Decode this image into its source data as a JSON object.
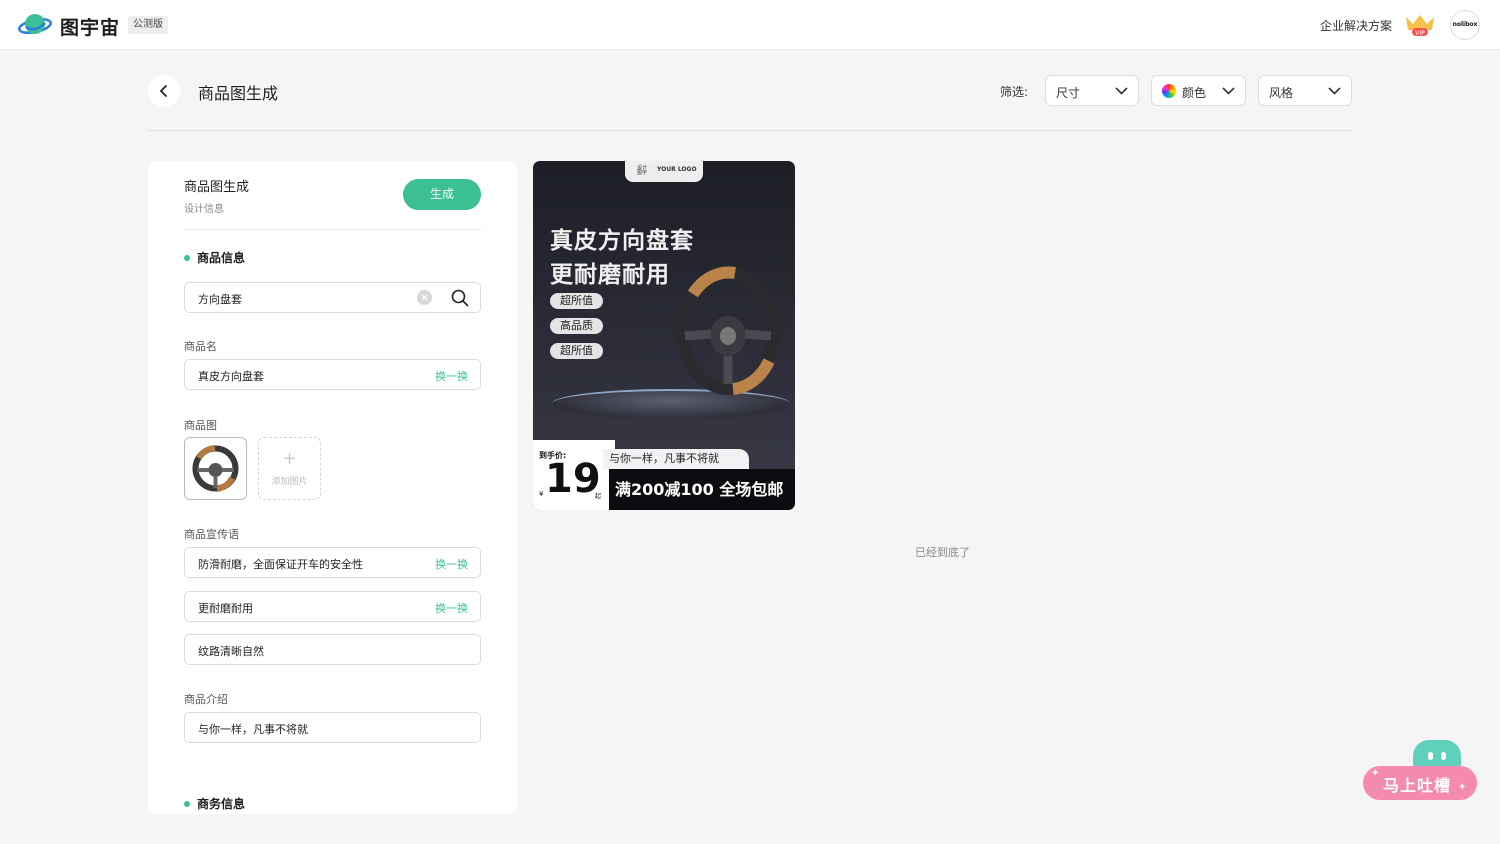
{
  "header": {
    "brand": "图宇宙",
    "beta_badge": "公测版",
    "enterprise_link": "企业解决方案",
    "vip_label": "VIP",
    "avatar_text": "nolibox"
  },
  "page": {
    "title": "商品图生成",
    "filter_label": "筛选:",
    "filters": {
      "size": "尺寸",
      "color": "颜色",
      "style": "风格"
    },
    "bottom_hint": "已经到底了"
  },
  "panel": {
    "title": "商品图生成",
    "subtitle": "设计信息",
    "generate_button": "生成",
    "section_product": "商品信息",
    "search_value": "方向盘套",
    "name_label": "商品名",
    "name_value": "真皮方向盘套",
    "swap_label": "换一换",
    "image_label": "商品图",
    "add_image_label": "添加图片",
    "slogan_label": "商品宣传语",
    "slogans": [
      "防滑耐磨，全面保证开车的安全性",
      "更耐磨耐用",
      "纹路清晰自然"
    ],
    "intro_label": "商品介绍",
    "intro_value": "与你一样，凡事不将就",
    "section_business": "商务信息"
  },
  "poster": {
    "logo_small": "设计 图宇",
    "logo_text": "YOUR LOGO",
    "headline_1": "真皮方向盘套",
    "headline_2": "更耐磨耐用",
    "tags": [
      "超所值",
      "高品质",
      "超所值"
    ],
    "price_label": "到手价:",
    "price_currency": "¥",
    "price_value": "19",
    "price_suffix": "起",
    "slogan": "与你一样，凡事不将就",
    "promo": "满200减100 全场包邮"
  },
  "feedback": {
    "label": "马上吐槽"
  },
  "colors": {
    "accent": "#3cbf95",
    "feedback_pink": "#f58ab0",
    "feedback_mint": "#5fd0bc"
  }
}
